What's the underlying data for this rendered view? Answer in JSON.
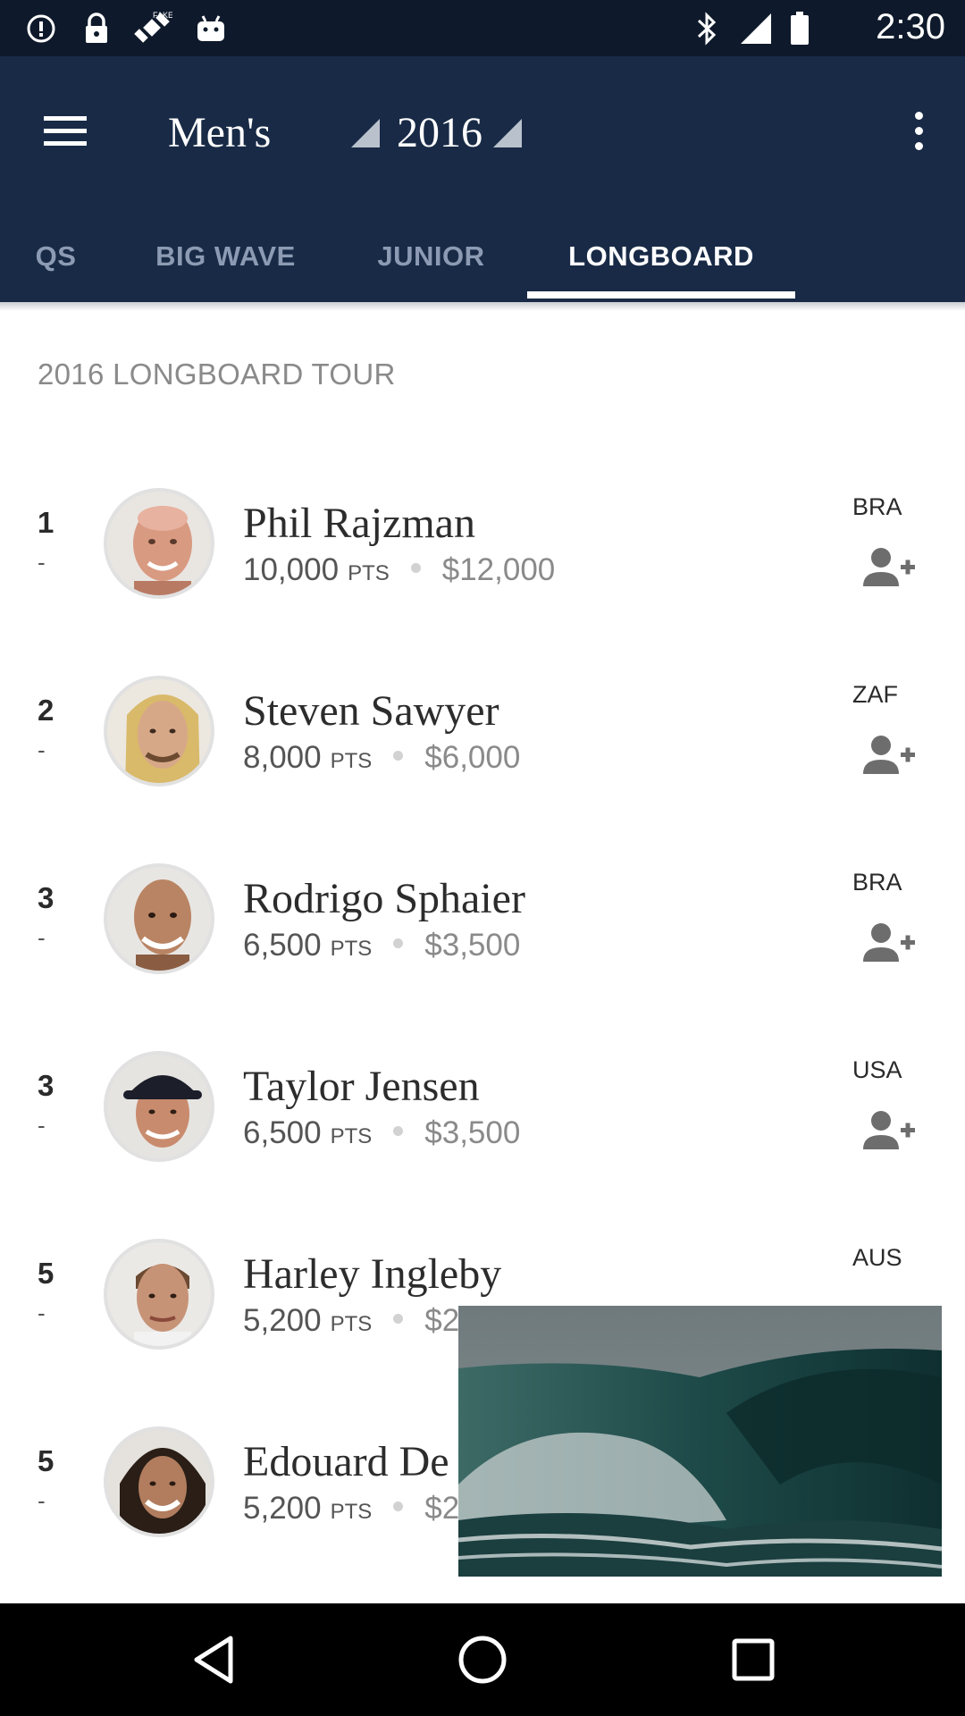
{
  "status_bar": {
    "time": "2:30",
    "icons": [
      "alert-circle-icon",
      "lock-icon",
      "fake-gps-icon",
      "android-icon",
      "bluetooth-icon",
      "signal-icon",
      "battery-icon"
    ]
  },
  "header": {
    "gender_select": "Men's",
    "year_select": "2016",
    "menu_icon": "hamburger-menu-icon",
    "overflow_icon": "more-vert-icon"
  },
  "tabs": [
    {
      "label": "QS",
      "active": false
    },
    {
      "label": "BIG WAVE",
      "active": false
    },
    {
      "label": "JUNIOR",
      "active": false
    },
    {
      "label": "LONGBOARD",
      "active": true
    }
  ],
  "section_title": "2016 LONGBOARD TOUR",
  "rankings": [
    {
      "rank": "1",
      "change": "-",
      "name": "Phil Rajzman",
      "points": "10,000",
      "pts_label": "PTS",
      "prize": "$12,000",
      "country": "BRA"
    },
    {
      "rank": "2",
      "change": "-",
      "name": "Steven Sawyer",
      "points": "8,000",
      "pts_label": "PTS",
      "prize": "$6,000",
      "country": "ZAF"
    },
    {
      "rank": "3",
      "change": "-",
      "name": "Rodrigo Sphaier",
      "points": "6,500",
      "pts_label": "PTS",
      "prize": "$3,500",
      "country": "BRA"
    },
    {
      "rank": "3",
      "change": "-",
      "name": "Taylor Jensen",
      "points": "6,500",
      "pts_label": "PTS",
      "prize": "$3,500",
      "country": "USA"
    },
    {
      "rank": "5",
      "change": "-",
      "name": "Harley Ingleby",
      "points": "5,200",
      "pts_label": "PTS",
      "prize": "$2",
      "country": "AUS"
    },
    {
      "rank": "5",
      "change": "-",
      "name": "Edouard De",
      "points": "5,200",
      "pts_label": "PTS",
      "prize": "$2",
      "country": ""
    }
  ],
  "colors": {
    "app_bar": "#182a46",
    "status_bar": "#0e1a2b",
    "tab_inactive": "#8c9bb3",
    "tab_active": "#ffffff"
  },
  "nav_bar": {
    "icons": [
      "back-icon",
      "home-icon",
      "recents-icon"
    ]
  }
}
